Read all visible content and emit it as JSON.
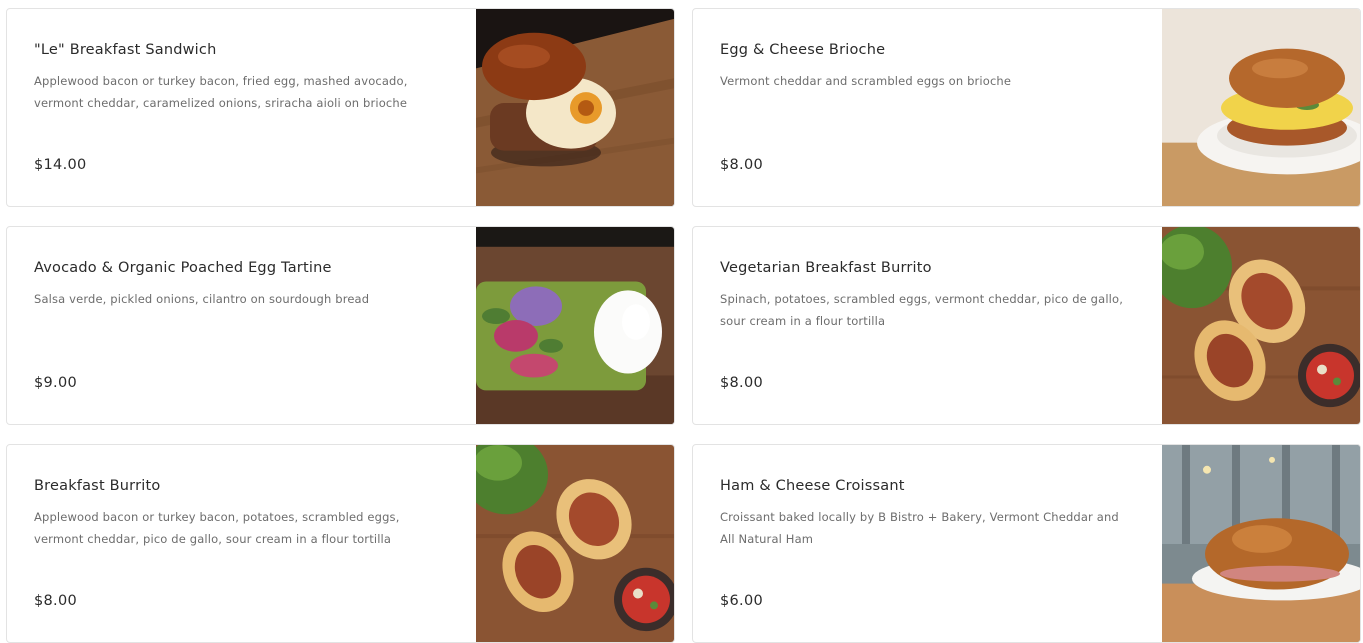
{
  "menu": {
    "items": [
      {
        "name": "\"Le\" Breakfast Sandwich",
        "description": "Applewood bacon or turkey bacon, fried egg, mashed avocado, vermont cheddar, caramelized onions, sriracha aioli on brioche",
        "price": "$14.00",
        "photo_icon": "breakfast-sandwich-photo"
      },
      {
        "name": "Egg & Cheese Brioche",
        "description": "Vermont cheddar and scrambled eggs on brioche",
        "price": "$8.00",
        "photo_icon": "egg-cheese-brioche-photo"
      },
      {
        "name": "Avocado & Organic Poached Egg Tartine",
        "description": "Salsa verde, pickled onions, cilantro on sourdough bread",
        "price": "$9.00",
        "photo_icon": "avocado-tartine-photo"
      },
      {
        "name": "Vegetarian Breakfast Burrito",
        "description": "Spinach, potatoes, scrambled eggs, vermont cheddar, pico de gallo, sour cream in a flour tortilla",
        "price": "$8.00",
        "photo_icon": "vegetarian-burrito-photo"
      },
      {
        "name": "Breakfast Burrito",
        "description": "Applewood bacon or turkey bacon, potatoes, scrambled eggs, vermont cheddar, pico de gallo, sour cream in a flour tortilla",
        "price": "$8.00",
        "photo_icon": "breakfast-burrito-photo"
      },
      {
        "name": "Ham & Cheese Croissant",
        "description": "Croissant baked locally by B Bistro + Bakery, Vermont Cheddar and All Natural Ham",
        "price": "$6.00",
        "photo_icon": "ham-cheese-croissant-photo"
      }
    ]
  },
  "colors": {
    "title_text": "#2b2b2b",
    "description_text": "#6d6d6d",
    "card_border": "#e3e3e3",
    "wood": "#8a5a36"
  }
}
